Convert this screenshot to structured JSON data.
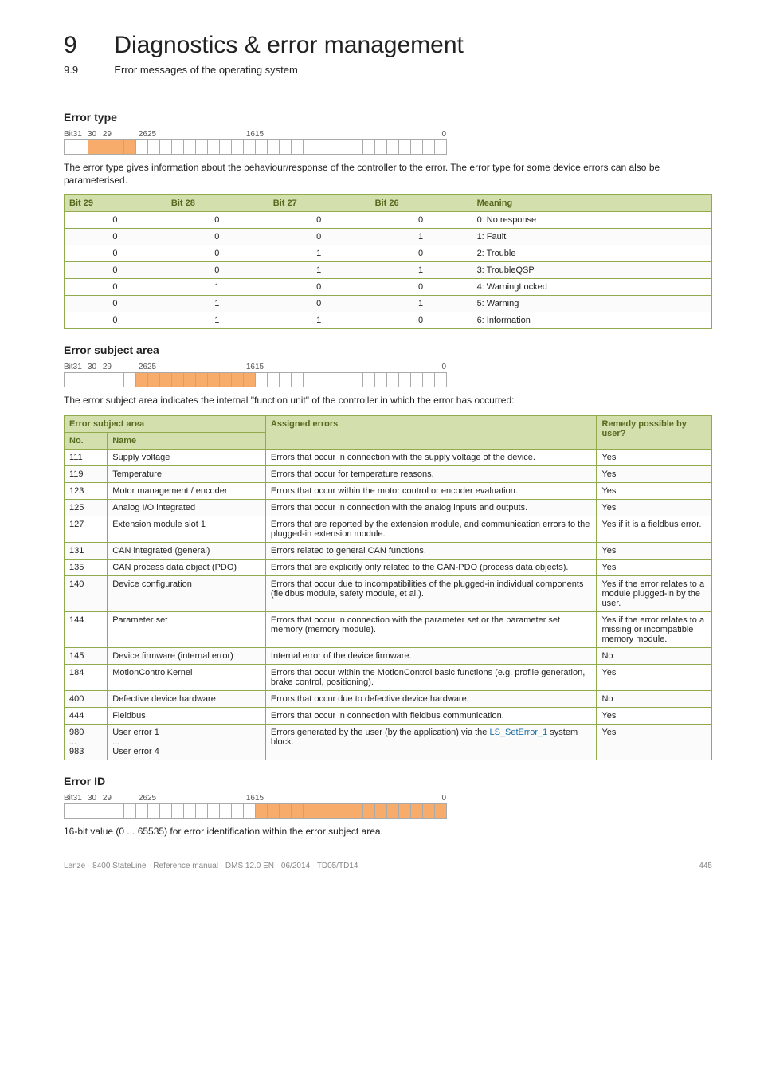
{
  "header": {
    "chapnum": "9",
    "chaptitle": "Diagnostics & error management",
    "secnum": "9.9",
    "sectitle": "Error messages of the operating system"
  },
  "bitLabels": {
    "b31": "Bit31",
    "b30": "30",
    "b29": "29",
    "b26": "26",
    "b25": "25",
    "b16": "16",
    "b15": "15",
    "b0": "0"
  },
  "errorType": {
    "heading": "Error type",
    "text": "The error type gives information about the behaviour/response of the controller to the error. The error type for some device errors can also be parameterised.",
    "columns": [
      "Bit 29",
      "Bit 28",
      "Bit 27",
      "Bit 26",
      "Meaning"
    ],
    "rows": [
      [
        "0",
        "0",
        "0",
        "0",
        "0: No response"
      ],
      [
        "0",
        "0",
        "0",
        "1",
        "1: Fault"
      ],
      [
        "0",
        "0",
        "1",
        "0",
        "2: Trouble"
      ],
      [
        "0",
        "0",
        "1",
        "1",
        "3: TroubleQSP"
      ],
      [
        "0",
        "1",
        "0",
        "0",
        "4: WarningLocked"
      ],
      [
        "0",
        "1",
        "0",
        "1",
        "5: Warning"
      ],
      [
        "0",
        "1",
        "1",
        "0",
        "6: Information"
      ]
    ]
  },
  "errorSubject": {
    "heading": "Error subject area",
    "text": "The error subject area indicates the internal \"function unit\" of the controller in which the error has occurred:",
    "columns": {
      "subj": "Error subject area",
      "no": "No.",
      "name": "Name",
      "assigned": "Assigned errors",
      "remedy": "Remedy possible by user?"
    },
    "rows": [
      {
        "no": "111",
        "name": "Supply voltage",
        "assigned": "Errors that occur in connection with the supply voltage of the device.",
        "remedy": "Yes"
      },
      {
        "no": "119",
        "name": "Temperature",
        "assigned": "Errors that occur for temperature reasons.",
        "remedy": "Yes"
      },
      {
        "no": "123",
        "name": "Motor management / encoder",
        "assigned": "Errors that occur within the motor control or encoder evaluation.",
        "remedy": "Yes"
      },
      {
        "no": "125",
        "name": "Analog I/O integrated",
        "assigned": "Errors that occur in connection with the analog inputs and outputs.",
        "remedy": "Yes"
      },
      {
        "no": "127",
        "name": "Extension module slot 1",
        "assigned": "Errors that are reported by the extension module, and communication errors to the plugged-in extension module.",
        "remedy": "Yes if it is a fieldbus error."
      },
      {
        "no": "131",
        "name": "CAN integrated (general)",
        "assigned": "Errors related to general CAN functions.",
        "remedy": "Yes"
      },
      {
        "no": "135",
        "name": "CAN process data object (PDO)",
        "assigned": "Errors that are explicitly only related to the CAN-PDO (process data objects).",
        "remedy": "Yes"
      },
      {
        "no": "140",
        "name": "Device configuration",
        "assigned": "Errors that occur due to incompatibilities of the plugged-in individual components (fieldbus module, safety module, et al.).",
        "remedy": "Yes if the error relates to a module plugged-in by the user."
      },
      {
        "no": "144",
        "name": "Parameter set",
        "assigned": "Errors that occur in connection with the parameter set or the parameter set memory (memory module).",
        "remedy": "Yes if the error relates to a missing or incompatible memory module."
      },
      {
        "no": "145",
        "name": "Device firmware (internal error)",
        "assigned": "Internal error of the device firmware.",
        "remedy": "No"
      },
      {
        "no": "184",
        "name": "MotionControlKernel",
        "assigned": "Errors that occur within the MotionControl basic functions (e.g. profile generation, brake control, positioning).",
        "remedy": "Yes"
      },
      {
        "no": "400",
        "name": "Defective device hardware",
        "assigned": "Errors that occur due to defective device hardware.",
        "remedy": "No"
      },
      {
        "no": "444",
        "name": "Fieldbus",
        "assigned": "Errors that occur in connection with fieldbus communication.",
        "remedy": "Yes"
      },
      {
        "no": "980\n...\n983",
        "name": "User error 1\n...\nUser error 4",
        "assigned_pre": "Errors generated by the user (by the application) via the ",
        "assigned_link": "LS_SetError_1",
        "assigned_post": " system block.",
        "remedy": "Yes"
      }
    ]
  },
  "errorID": {
    "heading": "Error ID",
    "text": "16-bit value (0 ... 65535) for error identification within the error subject area."
  },
  "footer": {
    "left": "Lenze · 8400 StateLine · Reference manual · DMS 12.0 EN · 06/2014 · TD05/TD14",
    "right": "445"
  }
}
